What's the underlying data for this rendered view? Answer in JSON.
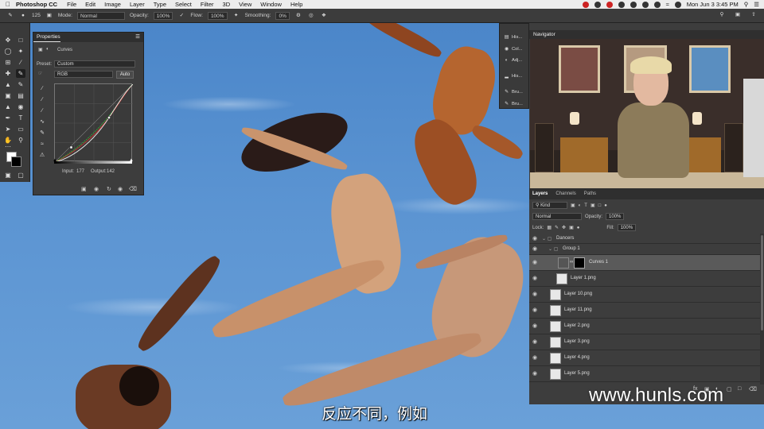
{
  "menubar": {
    "app_name": "Photoshop CC",
    "items": [
      "File",
      "Edit",
      "Image",
      "Layer",
      "Type",
      "Select",
      "Filter",
      "3D",
      "View",
      "Window",
      "Help"
    ],
    "clock": "Mon Jun 3  3:45 PM"
  },
  "options_bar": {
    "brush_size": "125",
    "mode_label": "Mode:",
    "mode_value": "Normal",
    "opacity_label": "Opacity:",
    "opacity_value": "100%",
    "flow_label": "Flow:",
    "flow_value": "100%",
    "smoothing_label": "Smoothing:",
    "smoothing_value": "0%"
  },
  "properties": {
    "title": "Properties",
    "adjustment": "Curves",
    "preset_label": "Preset:",
    "preset_value": "Custom",
    "channel_value": "RGB",
    "auto_label": "Auto",
    "input_label": "Input:",
    "input_value": "177",
    "output_label": "Output:",
    "output_value": "142"
  },
  "icon_strip": [
    {
      "icon": "history-icon",
      "label": "His..."
    },
    {
      "icon": "color-icon",
      "label": "Col..."
    },
    {
      "icon": "adjustments-icon",
      "label": "Adj..."
    },
    {
      "icon": "histogram-icon",
      "label": "His..."
    },
    {
      "icon": "brush-icon",
      "label": "Bru..."
    },
    {
      "icon": "brush-settings-icon",
      "label": "Bru..."
    }
  ],
  "navigator": {
    "title": "Navigator"
  },
  "layers_panel": {
    "tabs": [
      "Layers",
      "Channels",
      "Paths"
    ],
    "filter_value": "Kind",
    "blend_value": "Normal",
    "opacity_label": "Opacity:",
    "opacity_value": "100%",
    "lock_label": "Lock:",
    "fill_label": "Fill:",
    "fill_value": "100%",
    "layers": [
      {
        "name": "Dancers",
        "type": "group"
      },
      {
        "name": "Group 1",
        "type": "group"
      },
      {
        "name": "Curves 1",
        "type": "adjustment"
      },
      {
        "name": "Layer 1.png",
        "type": "image"
      },
      {
        "name": "Layer 10.png",
        "type": "image"
      },
      {
        "name": "Layer 11.png",
        "type": "image"
      },
      {
        "name": "Layer 2.png",
        "type": "image"
      },
      {
        "name": "Layer 3.png",
        "type": "image"
      },
      {
        "name": "Layer 4.png",
        "type": "image"
      },
      {
        "name": "Layer 5.png",
        "type": "image"
      }
    ]
  },
  "overlay": {
    "subtitle": "反应不同，例如",
    "watermark": "www.hunls.com"
  },
  "colors": {
    "sky": "#5b94d2",
    "panel_bg": "#3d3d3d",
    "panel_header": "#2f2f2f",
    "selected_layer": "#5a5a5a"
  }
}
